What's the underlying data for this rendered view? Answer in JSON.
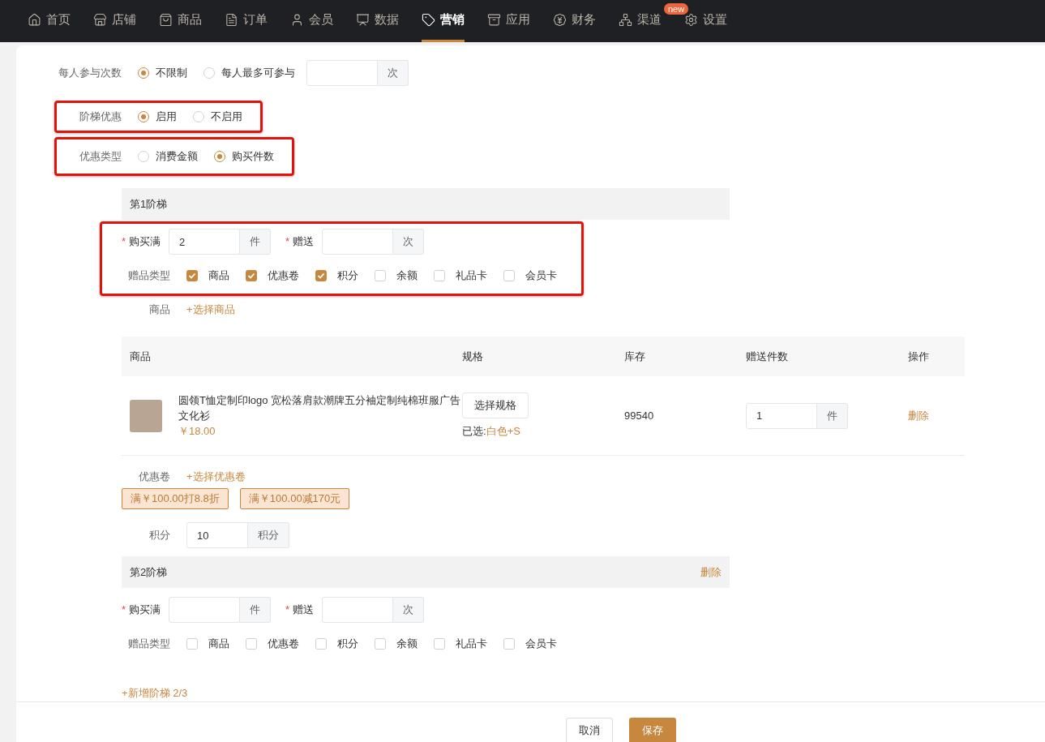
{
  "nav": [
    {
      "label": "首页",
      "selected": false
    },
    {
      "label": "店铺",
      "selected": false
    },
    {
      "label": "商品",
      "selected": false
    },
    {
      "label": "订单",
      "selected": false
    },
    {
      "label": "会员",
      "selected": false
    },
    {
      "label": "数据",
      "selected": false
    },
    {
      "label": "营销",
      "selected": true
    },
    {
      "label": "应用",
      "selected": false
    },
    {
      "label": "财务",
      "selected": false
    },
    {
      "label": "渠道",
      "selected": false,
      "badge": "new"
    },
    {
      "label": "设置",
      "selected": false
    }
  ],
  "form": {
    "participation": {
      "label": "每人参与次数",
      "options": [
        {
          "label": "不限制",
          "selected": true
        },
        {
          "label": "每人最多可参与",
          "selected": false
        }
      ],
      "unit": "次"
    },
    "tiered": {
      "label": "阶梯优惠",
      "highlighted": true,
      "options": [
        {
          "label": "启用",
          "selected": true
        },
        {
          "label": "不启用",
          "selected": false
        }
      ]
    },
    "discount_type": {
      "label": "优惠类型",
      "highlighted": true,
      "options": [
        {
          "label": "消费金额",
          "selected": false
        },
        {
          "label": "购买件数",
          "selected": true
        }
      ]
    },
    "tiers": [
      {
        "title": "第1阶梯",
        "highlighted": true,
        "buy": {
          "label": "购买满",
          "required_mark": "*",
          "value": "2",
          "unit": "件"
        },
        "gift": {
          "label": "赠送",
          "required_mark": "*",
          "unit": "次"
        },
        "gift_type": {
          "label": "赠品类型",
          "options": [
            {
              "label": "商品",
              "checked": true
            },
            {
              "label": "优惠卷",
              "checked": true
            },
            {
              "label": "积分",
              "checked": true
            },
            {
              "label": "余额",
              "checked": false
            },
            {
              "label": "礼品卡",
              "checked": false
            },
            {
              "label": "会员卡",
              "checked": false
            }
          ]
        },
        "products": {
          "label": "商品",
          "link": "+选择商品",
          "columns": [
            "商品",
            "规格",
            "库存",
            "赠送件数",
            "操作"
          ],
          "rows": [
            {
              "name": "圆领T恤定制印logo 宽松落肩款潮牌五分袖定制纯棉班服广告文化衫",
              "price": "￥18.00",
              "spec_button": "选择规格",
              "spec_prefix": "已选:",
              "spec_value": "白色+S",
              "stock": "99540",
              "qty": "1",
              "unit": "件",
              "action": "删除"
            }
          ]
        },
        "coupons": {
          "label": "优惠卷",
          "link": "+选择优惠卷",
          "items": [
            "满￥100.00打8.8折",
            "满￥100.00减170元"
          ]
        },
        "points": {
          "label": "积分",
          "value": "10",
          "unit": "积分"
        }
      },
      {
        "title": "第2阶梯",
        "delete": "删除",
        "buy": {
          "label": "购买满",
          "required_mark": "*",
          "unit": "件"
        },
        "gift": {
          "label": "赠送",
          "required_mark": "*",
          "unit": "次"
        },
        "gift_type": {
          "label": "赠品类型",
          "options": [
            {
              "label": "商品",
              "checked": false
            },
            {
              "label": "优惠卷",
              "checked": false
            },
            {
              "label": "积分",
              "checked": false
            },
            {
              "label": "余额",
              "checked": false
            },
            {
              "label": "礼品卡",
              "checked": false
            },
            {
              "label": "会员卡",
              "checked": false
            }
          ]
        }
      }
    ],
    "add_tier": "+新增阶梯 2/3"
  },
  "footer": {
    "buttons": [
      {
        "label": "取消",
        "kind": "secondary"
      },
      {
        "label": "保存",
        "kind": "primary"
      }
    ]
  }
}
